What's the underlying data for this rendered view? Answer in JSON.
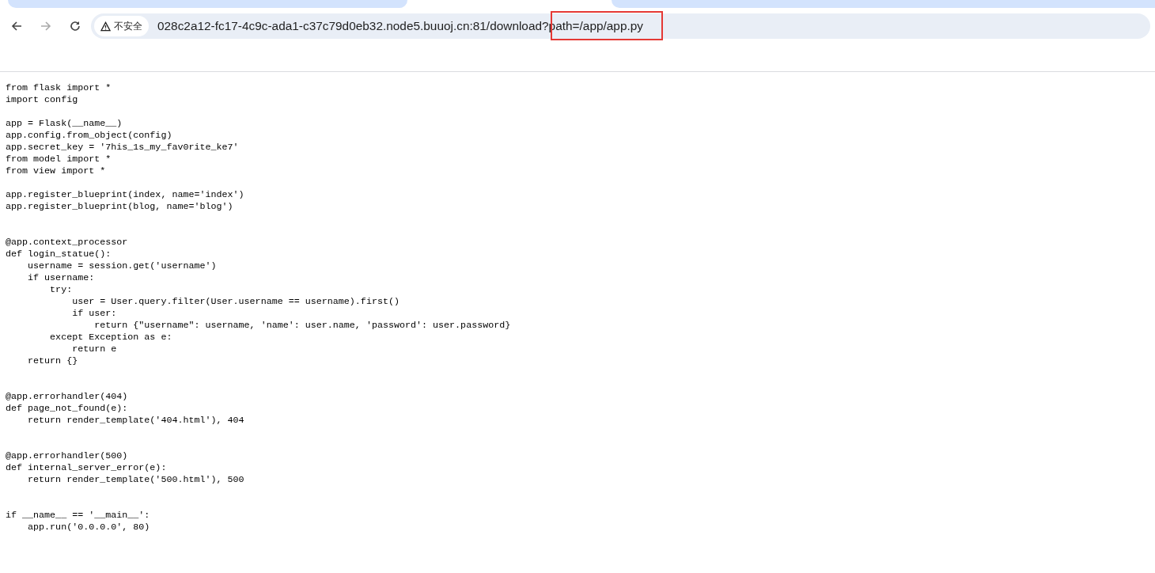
{
  "toolbar": {
    "security_label": "不安全",
    "url": "028c2a12-fc17-4c9c-ada1-c37c79d0eb32.node5.buuoj.cn:81/download?path=/app/app.py"
  },
  "page": {
    "code": "from flask import *\nimport config\n\napp = Flask(__name__)\napp.config.from_object(config)\napp.secret_key = '7his_1s_my_fav0rite_ke7'\nfrom model import *\nfrom view import *\n\napp.register_blueprint(index, name='index')\napp.register_blueprint(blog, name='blog')\n\n\n@app.context_processor\ndef login_statue():\n    username = session.get('username')\n    if username:\n        try:\n            user = User.query.filter(User.username == username).first()\n            if user:\n                return {\"username\": username, 'name': user.name, 'password': user.password}\n        except Exception as e:\n            return e\n    return {}\n\n\n@app.errorhandler(404)\ndef page_not_found(e):\n    return render_template('404.html'), 404\n\n\n@app.errorhandler(500)\ndef internal_server_error(e):\n    return render_template('500.html'), 500\n\n\nif __name__ == '__main__':\n    app.run('0.0.0.0', 80)"
  }
}
